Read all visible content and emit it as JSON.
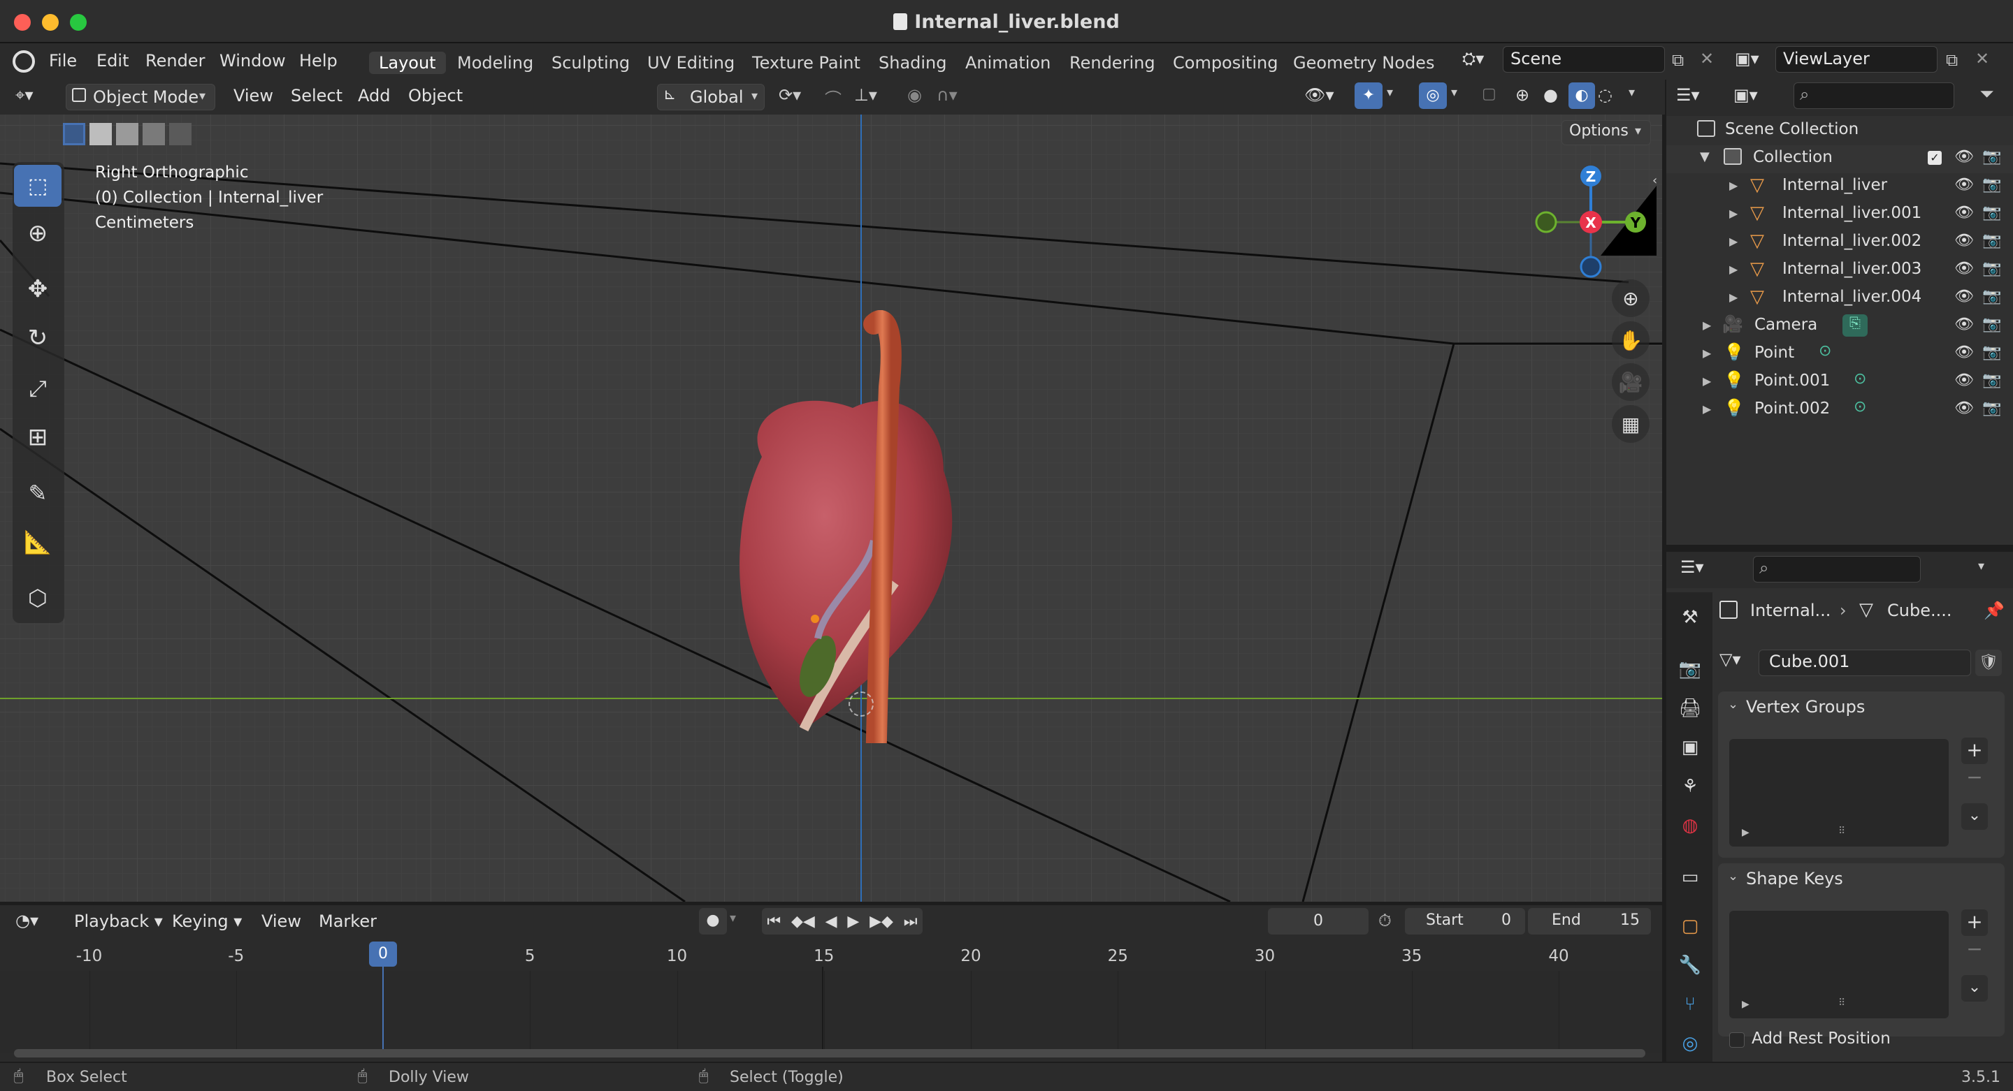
{
  "window": {
    "title": "Internal_liver.blend",
    "version": "3.5.1"
  },
  "menus": [
    "File",
    "Edit",
    "Render",
    "Window",
    "Help"
  ],
  "workspaces": [
    "Layout",
    "Modeling",
    "Sculpting",
    "UV Editing",
    "Texture Paint",
    "Shading",
    "Animation",
    "Rendering",
    "Compositing",
    "Geometry Nodes"
  ],
  "active_workspace": "Layout",
  "scene": {
    "name": "Scene"
  },
  "view_layer": {
    "name": "ViewLayer"
  },
  "viewport_header": {
    "mode": "Object Mode",
    "menus": [
      "View",
      "Select",
      "Add",
      "Object"
    ],
    "orientation": "Global",
    "options": "Options"
  },
  "viewport_info": {
    "line1": "Right Orthographic",
    "line2": "(0) Collection | Internal_liver",
    "line3": "Centimeters"
  },
  "gizmo": {
    "z": "Z",
    "x": "X",
    "y": "Y"
  },
  "outliner": {
    "scene_collection": "Scene Collection",
    "collection": "Collection",
    "meshes": [
      "Internal_liver",
      "Internal_liver.001",
      "Internal_liver.002",
      "Internal_liver.003",
      "Internal_liver.004"
    ],
    "objects": [
      "Camera",
      "Point",
      "Point.001",
      "Point.002"
    ]
  },
  "properties": {
    "breadcrumb_object": "Internal...",
    "breadcrumb_mesh": "Cube....",
    "mesh_name": "Cube.001",
    "vertex_groups": "Vertex Groups",
    "shape_keys": "Shape Keys",
    "add_rest_position": "Add Rest Position"
  },
  "timeline": {
    "menus": [
      "Playback",
      "Keying",
      "View",
      "Marker"
    ],
    "current_frame": "0",
    "start_label": "Start",
    "start": "0",
    "end_label": "End",
    "end": "15",
    "ticks": [
      "-10",
      "-5",
      "0",
      "5",
      "10",
      "15",
      "20",
      "25",
      "30",
      "35",
      "40"
    ]
  },
  "statusbar": {
    "left": "Box Select",
    "middle": "Dolly View",
    "right": "Select (Toggle)"
  },
  "colors": {
    "accent": "#4772b3",
    "x_axis": "#e8334a",
    "y_axis": "#6db22e",
    "z_axis": "#2f7fd6",
    "mesh_icon": "#e89a4a",
    "light_icon": "#e0a040"
  }
}
